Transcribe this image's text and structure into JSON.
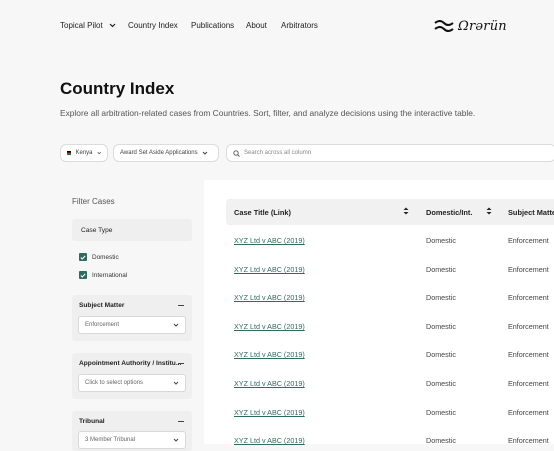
{
  "nav": {
    "items": [
      "Topical Pilot",
      "Country Index",
      "Publications",
      "About",
      "Arbitrators"
    ],
    "logo_text": "Ωrǝrün"
  },
  "page": {
    "title": "Country Index",
    "subtitle": "Explore all arbitration-related cases from Countries. Sort, filter, and analyze decisions using the interactive table."
  },
  "toolbar": {
    "country": "Kenya",
    "case_type_filter": "Award Set Aside Applications",
    "search_placeholder": "Search across all column"
  },
  "filters": {
    "title": "Filter Cases",
    "case_type": {
      "label": "Case Type",
      "options": [
        "Domestic",
        "International"
      ]
    },
    "subject_matter": {
      "label": "Subject Matter",
      "value": "Enforcement"
    },
    "appointment": {
      "label": "Appointment Authority / Institu...",
      "placeholder": "Click to select options"
    },
    "tribunal": {
      "label": "Tribunal",
      "value": "3 Member Tribunal"
    }
  },
  "table": {
    "columns": [
      "Case Title (Link)",
      "Domestic/Int.",
      "Subject Matte"
    ],
    "rows": [
      [
        "XYZ Ltd v ABC (2019)",
        "Domestic",
        "Enforcement"
      ],
      [
        "XYZ Ltd v ABC (2019)",
        "Domestic",
        "Enforcement"
      ],
      [
        "XYZ Ltd v ABC (2019)",
        "Domestic",
        "Enforcement"
      ],
      [
        "XYZ Ltd v ABC (2019)",
        "Domestic",
        "Enforcement"
      ],
      [
        "XYZ Ltd v ABC (2019)",
        "Domestic",
        "Enforcement"
      ],
      [
        "XYZ Ltd v ABC (2019)",
        "Domestic",
        "Enforcement"
      ],
      [
        "XYZ Ltd v ABC (2019)",
        "Domestic",
        "Enforcement"
      ],
      [
        "XYZ Ltd v ABC (2019)",
        "Domestic",
        "Enforcement"
      ]
    ]
  },
  "colors": {
    "accent": "#2f6b5e",
    "background": "#f7f7f7"
  }
}
